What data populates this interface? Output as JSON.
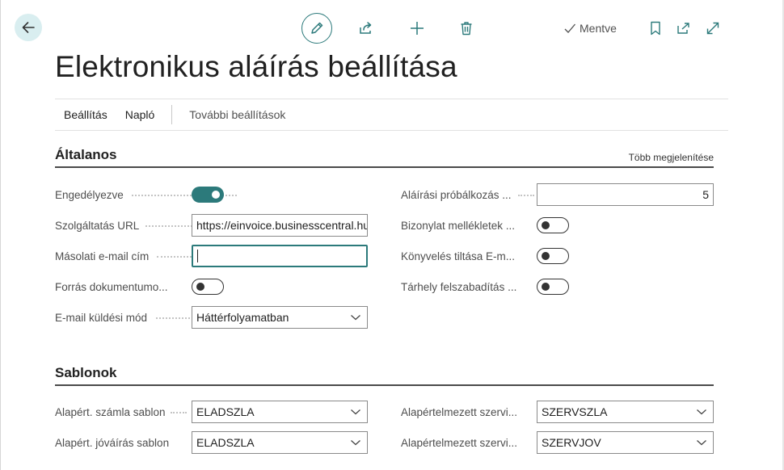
{
  "toolbar": {
    "saved_label": "Mentve",
    "icons": [
      "back-icon",
      "pencil-icon",
      "share-icon",
      "plus-icon",
      "trash-icon",
      "check-icon",
      "bookmark-icon",
      "open-in-new-window-icon",
      "expand-icon"
    ]
  },
  "page": {
    "title": "Elektronikus aláírás beállítása"
  },
  "actions": {
    "items": [
      "Beállítás",
      "Napló",
      "További beállítások"
    ]
  },
  "general": {
    "title": "Általanos",
    "show_more": "Több megjelenítése",
    "left": {
      "enabled": {
        "label": "Engedélyezve",
        "value": true
      },
      "service_url": {
        "label": "Szolgáltatás URL",
        "value": "https://einvoice.businesscentral.hu"
      },
      "copy_email": {
        "label": "Másolati e-mail cím",
        "value": ""
      },
      "source_doc": {
        "label": "Forrás dokumentumo...",
        "value": false
      },
      "email_mode": {
        "label": "E-mail küldési mód",
        "value": "Háttérfolyamatban"
      }
    },
    "right": {
      "sign_attempts": {
        "label": "Aláírási próbálkozás ...",
        "value": "5"
      },
      "doc_attachments": {
        "label": "Bizonylat mellékletek ...",
        "value": false
      },
      "block_posting": {
        "label": "Könyvelés tiltása E-m...",
        "value": false
      },
      "free_storage": {
        "label": "Tárhely felszabadítás ...",
        "value": false
      }
    }
  },
  "templates": {
    "title": "Sablonok",
    "left": {
      "invoice_template": {
        "label": "Alapért. számla sablon",
        "value": "ELADSZLA"
      },
      "credit_template": {
        "label": "Alapért. jóváírás sablon",
        "value": "ELADSZLA"
      }
    },
    "right": {
      "service_invoice": {
        "label": "Alapértelmezett szervi...",
        "value": "SZERVSZLA"
      },
      "service_credit": {
        "label": "Alapértelmezett szervi...",
        "value": "SZERVJOV"
      }
    }
  },
  "colors": {
    "accent": "#2c7a7b",
    "back_button_bg": "#d9eef0"
  }
}
